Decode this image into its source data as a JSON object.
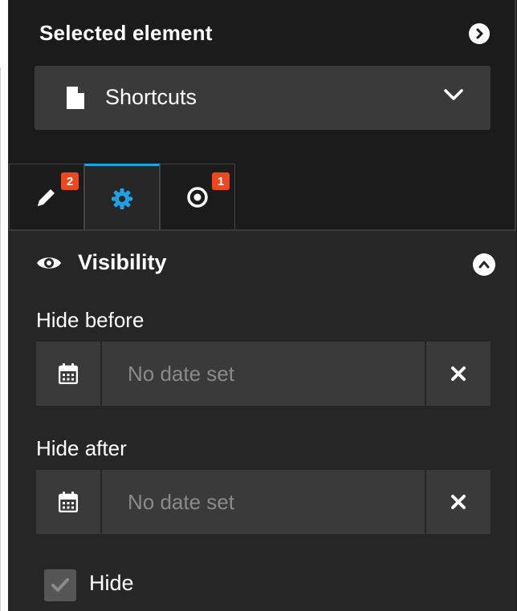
{
  "header": {
    "title": "Selected element",
    "expand_icon": "chevron-right-circle-icon"
  },
  "element_select": {
    "value": "Shortcuts",
    "icon": "document-icon",
    "toggle_icon": "chevron-down-icon"
  },
  "tabs": [
    {
      "icon": "pencil-icon",
      "badge": "2",
      "active": false
    },
    {
      "icon": "gear-icon",
      "badge": "",
      "active": true
    },
    {
      "icon": "target-icon",
      "badge": "1",
      "active": false
    }
  ],
  "visibility": {
    "title": "Visibility",
    "icon": "eye-icon",
    "collapse_icon": "chevron-up-circle-icon",
    "hide_before": {
      "label": "Hide before",
      "placeholder": "No date set",
      "value": ""
    },
    "hide_after": {
      "label": "Hide after",
      "placeholder": "No date set",
      "value": ""
    },
    "hide": {
      "label": "Hide",
      "checked": true
    }
  },
  "colors": {
    "accent": "#1fa0e0",
    "badge": "#f0461e",
    "panel": "#262626",
    "control": "#3a3a3a"
  }
}
